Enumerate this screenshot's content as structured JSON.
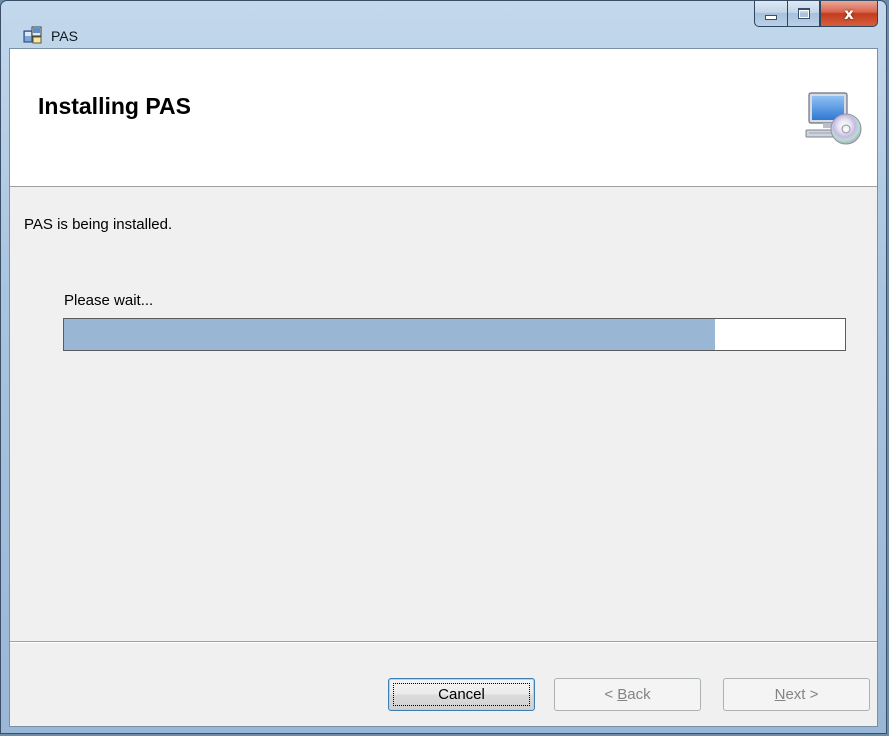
{
  "window": {
    "title": "PAS",
    "controls": {
      "minimize_icon": "minimize-icon",
      "maximize_icon": "maximize-icon",
      "close_label": "x"
    }
  },
  "header": {
    "title": "Installing PAS",
    "icon": "computer-cd-icon"
  },
  "body": {
    "status": "PAS is being installed.",
    "wait_label": "Please wait...",
    "progress_fraction": 0.834
  },
  "buttons": {
    "cancel": "Cancel",
    "back_prefix": "< ",
    "back_mnemonic": "B",
    "back_rest": "ack",
    "next_mnemonic": "N",
    "next_rest": "ext >"
  },
  "colors": {
    "progress_fill": "#9ab6d5",
    "close_button": "#c23b1e",
    "title_bar": "#a9c4e0"
  }
}
